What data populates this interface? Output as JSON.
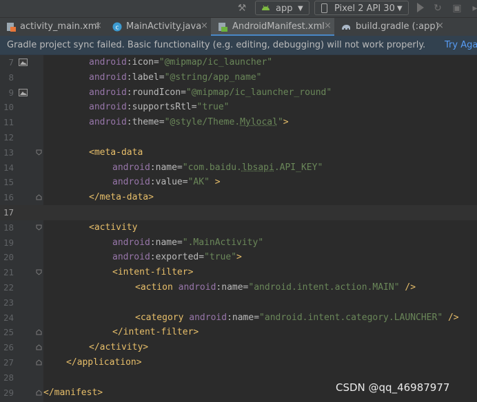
{
  "toolbar": {
    "run_config": "app",
    "device": "Pixel 2 API 30",
    "icons": [
      "hammer-icon",
      "android-icon",
      "phone-icon",
      "run-icon",
      "rerun-icon",
      "debug-icon"
    ]
  },
  "tabs": [
    {
      "label": "activity_main.xml",
      "icon": "xml-layout-icon",
      "active": false
    },
    {
      "label": "MainActivity.java",
      "icon": "java-class-icon",
      "active": false
    },
    {
      "label": "AndroidManifest.xml",
      "icon": "manifest-icon",
      "active": true
    },
    {
      "label": "build.gradle (:app)",
      "icon": "gradle-icon",
      "active": false
    }
  ],
  "banner": {
    "message": "Gradle project sync failed. Basic functionality (e.g. editing, debugging) will not work properly.",
    "action": "Try Aga"
  },
  "editor": {
    "current_line": 17,
    "lines": [
      {
        "n": "7",
        "s": [
          {
            "c": "t-ns",
            "t": "android"
          },
          {
            "c": "t-attr",
            "t": ":icon="
          },
          {
            "c": "t-val",
            "t": "\"@mipmap/ic_launcher\""
          }
        ]
      },
      {
        "n": "8",
        "s": [
          {
            "c": "t-ns",
            "t": "android"
          },
          {
            "c": "t-attr",
            "t": ":label="
          },
          {
            "c": "t-val",
            "t": "\"@string/app_name\""
          }
        ]
      },
      {
        "n": "9",
        "s": [
          {
            "c": "t-ns",
            "t": "android"
          },
          {
            "c": "t-attr",
            "t": ":roundIcon="
          },
          {
            "c": "t-val",
            "t": "\"@mipmap/ic_launcher_round\""
          }
        ]
      },
      {
        "n": "10",
        "s": [
          {
            "c": "t-ns",
            "t": "android"
          },
          {
            "c": "t-attr",
            "t": ":supportsRtl="
          },
          {
            "c": "t-val",
            "t": "\"true\""
          }
        ]
      },
      {
        "n": "11",
        "s": [
          {
            "c": "t-ns",
            "t": "android"
          },
          {
            "c": "t-attr",
            "t": ":theme="
          },
          {
            "c": "t-val",
            "t": "\"@style/Theme."
          },
          {
            "c": "t-val u",
            "t": "Mylocal"
          },
          {
            "c": "t-val",
            "t": "\""
          },
          {
            "c": "t-p",
            "t": ">"
          }
        ]
      },
      {
        "n": "12",
        "s": []
      },
      {
        "n": "13",
        "s": [
          {
            "c": "t-tag",
            "t": "<meta-data"
          }
        ]
      },
      {
        "n": "14",
        "s": [
          {
            "c": "t-ns",
            "t": "android"
          },
          {
            "c": "t-attr",
            "t": ":name="
          },
          {
            "c": "t-val",
            "t": "\"com.baidu."
          },
          {
            "c": "t-val u",
            "t": "lbsapi"
          },
          {
            "c": "t-val",
            "t": ".API_KEY\""
          }
        ]
      },
      {
        "n": "15",
        "s": [
          {
            "c": "t-ns",
            "t": "android"
          },
          {
            "c": "t-attr",
            "t": ":value="
          },
          {
            "c": "t-val",
            "t": "\"AK\""
          },
          {
            "c": "t-p",
            "t": " >"
          }
        ]
      },
      {
        "n": "16",
        "s": [
          {
            "c": "t-tag",
            "t": "</meta-data>"
          }
        ]
      },
      {
        "n": "17",
        "s": []
      },
      {
        "n": "18",
        "s": [
          {
            "c": "t-tag",
            "t": "<activity"
          }
        ]
      },
      {
        "n": "19",
        "s": [
          {
            "c": "t-ns",
            "t": "android"
          },
          {
            "c": "t-attr",
            "t": ":name="
          },
          {
            "c": "t-val",
            "t": "\".MainActivity\""
          }
        ]
      },
      {
        "n": "20",
        "s": [
          {
            "c": "t-ns",
            "t": "android"
          },
          {
            "c": "t-attr",
            "t": ":exported="
          },
          {
            "c": "t-val",
            "t": "\"true\""
          },
          {
            "c": "t-p",
            "t": ">"
          }
        ]
      },
      {
        "n": "21",
        "s": [
          {
            "c": "t-tag",
            "t": "<intent-filter>"
          }
        ]
      },
      {
        "n": "22",
        "s": [
          {
            "c": "t-tag",
            "t": "<action "
          },
          {
            "c": "t-ns",
            "t": "android"
          },
          {
            "c": "t-attr",
            "t": ":name="
          },
          {
            "c": "t-val",
            "t": "\"android.intent.action.MAIN\""
          },
          {
            "c": "t-p",
            "t": " />"
          }
        ]
      },
      {
        "n": "23",
        "s": []
      },
      {
        "n": "24",
        "s": [
          {
            "c": "t-tag",
            "t": "<category "
          },
          {
            "c": "t-ns",
            "t": "android"
          },
          {
            "c": "t-attr",
            "t": ":name="
          },
          {
            "c": "t-val",
            "t": "\"android.intent.category.LAUNCHER\""
          },
          {
            "c": "t-p",
            "t": " />"
          }
        ]
      },
      {
        "n": "25",
        "s": [
          {
            "c": "t-tag",
            "t": "</intent-filter>"
          }
        ]
      },
      {
        "n": "26",
        "s": [
          {
            "c": "t-tag",
            "t": "</activity>"
          }
        ]
      },
      {
        "n": "27",
        "s": [
          {
            "c": "t-tag",
            "t": "</application>"
          }
        ]
      },
      {
        "n": "28",
        "s": []
      },
      {
        "n": "29",
        "s": [
          {
            "c": "t-tag",
            "t": "</manifest>"
          }
        ]
      }
    ]
  },
  "watermark": "CSDN @qq_46987977"
}
